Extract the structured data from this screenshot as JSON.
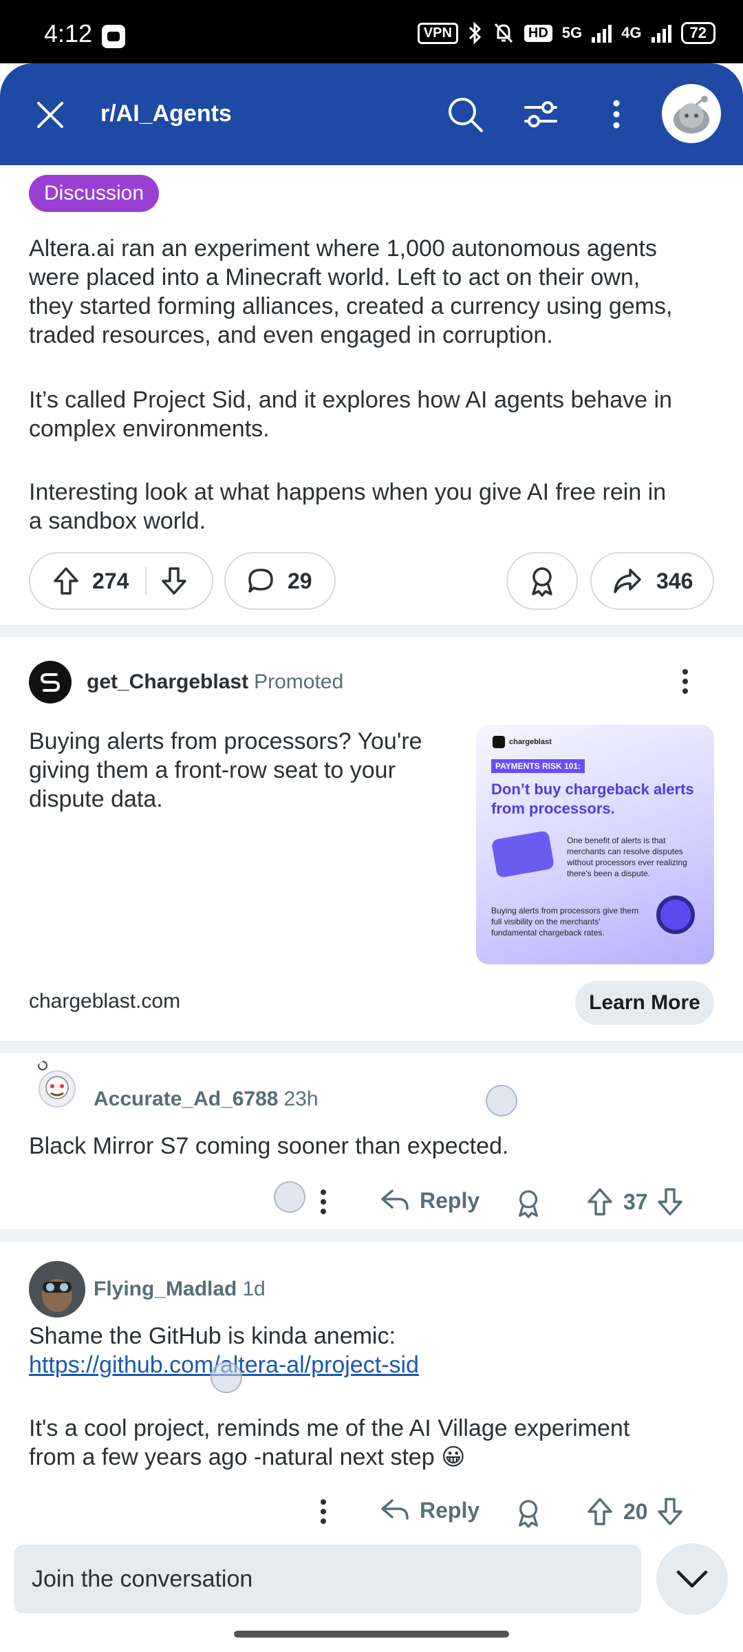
{
  "status_bar": {
    "time": "4:12",
    "vpn": "VPN",
    "hd": "HD",
    "net1": "5G",
    "net2": "4G",
    "battery": "72"
  },
  "header": {
    "title": "r/AI_Agents",
    "bg_color": "#1e4aa6"
  },
  "post": {
    "flair": "Discussion",
    "paragraphs": [
      [
        "Altera.ai ran an experiment where 1,000 autonomous agents",
        "were placed into a Minecraft world. Left to act on their own,",
        "they started forming alliances, created a currency using gems,",
        "traded resources, and even engaged in corruption."
      ],
      [
        "It’s called Project Sid, and it explores how AI agents behave in",
        "complex environments."
      ],
      [
        "Interesting look at what happens when you give AI free rein in",
        "a sandbox world."
      ]
    ],
    "upvotes": "274",
    "comments": "29",
    "shares": "346"
  },
  "ad": {
    "advertiser": "get_Chargeblast",
    "promoted_label": "Promoted",
    "text": [
      "Buying alerts from processors? You're",
      "giving them a front-row seat to your",
      "dispute data."
    ],
    "image": {
      "brand": "chargeblast",
      "kicker": "PAYMENTS RISK 101:",
      "headline": "Don’t buy chargeback alerts from processors.",
      "note1": "One benefit of alerts is that merchants can resolve disputes without processors ever realizing there's been a dispute.",
      "note2": "Buying alerts from processors give them full visibility on the merchants' fundamental chargeback rates."
    },
    "domain": "chargeblast.com",
    "cta": "Learn More"
  },
  "comments": [
    {
      "user": "Accurate_Ad_6788",
      "age": "23h",
      "lines": [
        "Black Mirror S7 coming sooner than expected."
      ],
      "reply": "Reply",
      "votes": "37"
    },
    {
      "user": "Flying_Madlad",
      "age": "1d",
      "line1": "Shame the GitHub is kinda anemic:",
      "link": "https://github.com/altera-al/project-sid",
      "para2": [
        "It's a cool project, reminds me of the AI Village experiment",
        "from a few years ago -natural next step 😀"
      ],
      "reply": "Reply",
      "votes": "20"
    }
  ],
  "composer": {
    "placeholder": "Join the conversation"
  }
}
